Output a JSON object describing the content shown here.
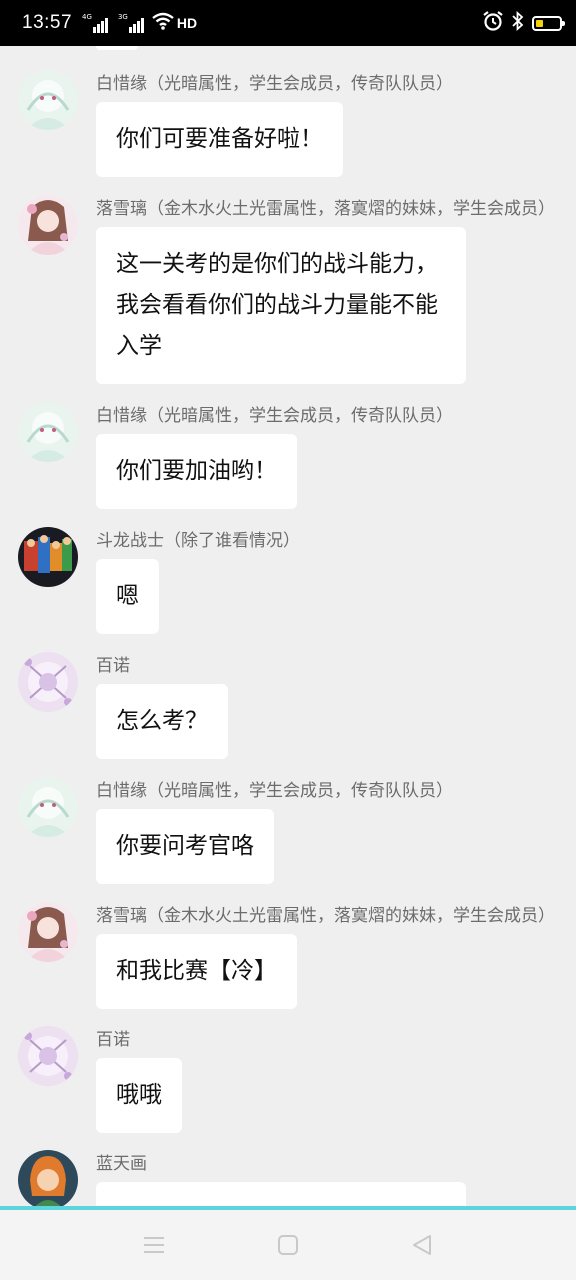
{
  "status_bar": {
    "time": "13:57",
    "net1": "4G",
    "net2": "3G",
    "hd": "HD"
  },
  "messages": [
    {
      "sender": "白惜缘（光暗属性，学生会成员，传奇队队员）",
      "text": "你们可要准备好啦！",
      "avatar": "girl-avatar-white"
    },
    {
      "sender": "落雪璃（金木水火土光雷属性，落寞熠的妹妹，学生会成员）",
      "text": "这一关考的是你们的战斗能力，我会看看你们的战斗力量能不能入学",
      "avatar": "girl-avatar-brown-hair"
    },
    {
      "sender": "白惜缘（光暗属性，学生会成员，传奇队队员）",
      "text": "你们要加油哟！",
      "avatar": "girl-avatar-white"
    },
    {
      "sender": "斗龙战士（除了谁看情况）",
      "text": "嗯",
      "avatar": "group-avatar-dragon-warriors"
    },
    {
      "sender": "百诺",
      "text": "怎么考？",
      "avatar": "girl-avatar-purple"
    },
    {
      "sender": "白惜缘（光暗属性，学生会成员，传奇队队员）",
      "text": "你要问考官咯",
      "avatar": "girl-avatar-white"
    },
    {
      "sender": "落雪璃（金木水火土光雷属性，落寞熠的妹妹，学生会成员）",
      "text": "和我比赛【冷】",
      "avatar": "girl-avatar-brown-hair"
    },
    {
      "sender": "百诺",
      "text": "哦哦",
      "avatar": "girl-avatar-purple"
    },
    {
      "sender": "蓝天画",
      "text": "",
      "avatar": "boy-avatar-orange-hair"
    }
  ],
  "colors": {
    "background": "#efefef",
    "bubble": "#ffffff",
    "sender_text": "#6c6c6c",
    "accent_bar": "#5ed5dc",
    "battery": "#f5d10a"
  }
}
